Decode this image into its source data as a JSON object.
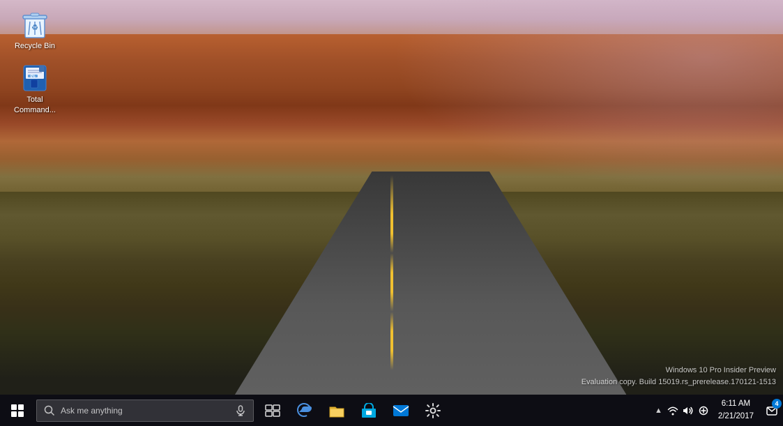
{
  "desktop": {
    "icons": [
      {
        "id": "recycle-bin",
        "label": "Recycle Bin",
        "type": "recycle-bin"
      },
      {
        "id": "total-commander",
        "label": "Total Command...",
        "type": "total-commander"
      }
    ]
  },
  "watermark": {
    "line1": "Windows 10 Pro Insider Preview",
    "line2": "Evaluation copy. Build 15019.rs_prerelease.170121-1513"
  },
  "taskbar": {
    "start_label": "Start",
    "search_placeholder": "Ask me anything",
    "items": [
      {
        "id": "task-view",
        "label": "Task View",
        "icon": "⧉"
      },
      {
        "id": "edge",
        "label": "Microsoft Edge",
        "icon": "e"
      },
      {
        "id": "file-explorer",
        "label": "File Explorer",
        "icon": "📁"
      },
      {
        "id": "store",
        "label": "Microsoft Store",
        "icon": "🛍"
      },
      {
        "id": "mail",
        "label": "Mail",
        "icon": "✉"
      },
      {
        "id": "settings",
        "label": "Settings",
        "icon": "⚙"
      }
    ],
    "tray": {
      "chevron": "^",
      "icons": [
        {
          "id": "network",
          "label": "Network",
          "icon": "📶"
        },
        {
          "id": "volume",
          "label": "Volume",
          "icon": "🔊"
        },
        {
          "id": "battery",
          "label": "Battery / Action Center notifications",
          "icon": "🔋"
        }
      ],
      "clock": {
        "time": "6:11 AM",
        "date": "2/21/2017"
      },
      "notification": {
        "icon": "💬",
        "count": "4"
      }
    }
  }
}
